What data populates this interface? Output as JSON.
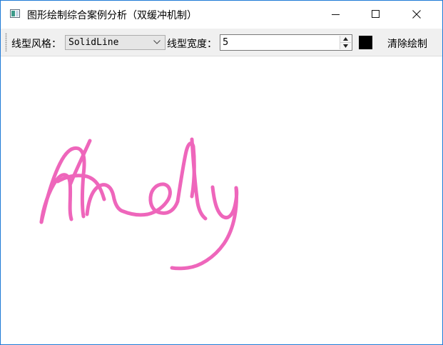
{
  "window": {
    "title": "图形绘制综合案例分析（双缓冲机制）",
    "icon": "app-window-icon",
    "controls": [
      "minimize-icon",
      "maximize-icon",
      "close-icon"
    ]
  },
  "toolbar": {
    "line_style_label": "线型风格：",
    "line_style_value": "SolidLine",
    "line_width_label": "线型宽度：",
    "line_width_value": "5",
    "pen_color": "#000000",
    "clear_label": "清除绘制"
  },
  "canvas": {
    "stroke_color": "#ee66bb"
  }
}
